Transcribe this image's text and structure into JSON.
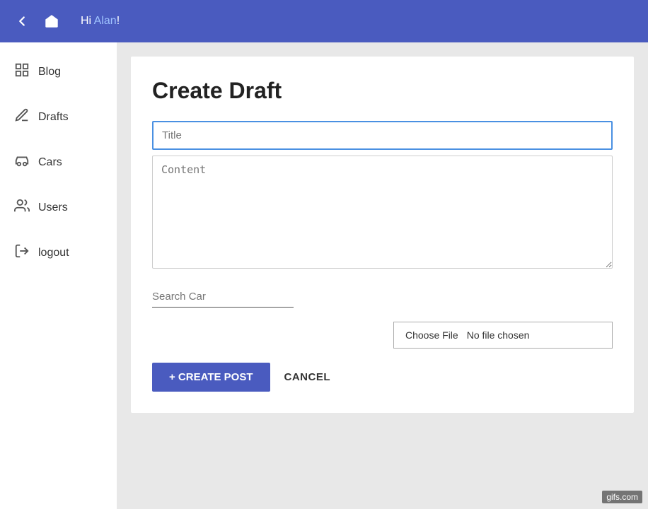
{
  "topbar": {
    "greeting_prefix": "Hi ",
    "username": "Alan",
    "greeting_suffix": "!"
  },
  "sidebar": {
    "items": [
      {
        "id": "blog",
        "label": "Blog",
        "icon": "⊞"
      },
      {
        "id": "drafts",
        "label": "Drafts",
        "icon": "✏"
      },
      {
        "id": "cars",
        "label": "Cars",
        "icon": "🚗"
      },
      {
        "id": "users",
        "label": "Users",
        "icon": "👥"
      },
      {
        "id": "logout",
        "label": "logout",
        "icon": "➜"
      }
    ]
  },
  "main": {
    "page_title": "Create Draft",
    "title_placeholder": "Title",
    "content_placeholder": "Content",
    "search_car_placeholder": "Search Car",
    "file_choose_label": "Choose File",
    "file_no_chosen": "No file chosen",
    "create_btn_label": "+ CREATE POST",
    "cancel_btn_label": "CANCEL"
  },
  "watermark": "gifs.com"
}
